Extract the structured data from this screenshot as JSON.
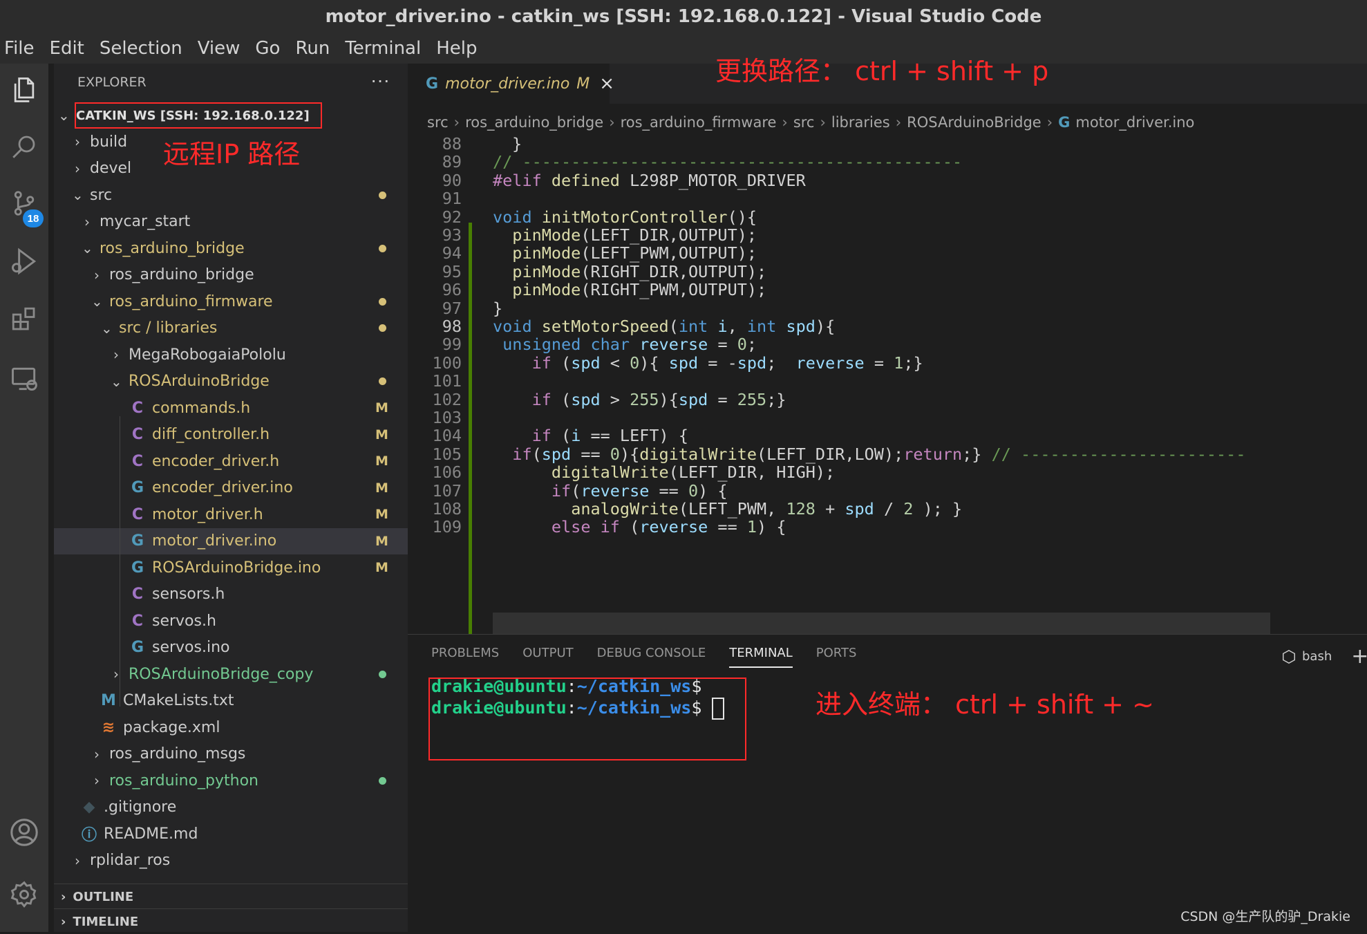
{
  "window": {
    "title": "motor_driver.ino - catkin_ws [SSH: 192.168.0.122] - Visual Studio Code"
  },
  "menu": [
    "File",
    "Edit",
    "Selection",
    "View",
    "Go",
    "Run",
    "Terminal",
    "Help"
  ],
  "activity_bar": {
    "items": [
      "explorer-icon",
      "search-icon",
      "source-control-icon",
      "run-debug-icon",
      "extensions-icon",
      "remote-explorer-icon"
    ],
    "source_control_badge": "18",
    "bottom": [
      "account-icon",
      "gear-icon"
    ]
  },
  "explorer": {
    "header": "EXPLORER",
    "more": "···",
    "root": "CATKIN_WS [SSH: 192.168.0.122]",
    "tree": [
      {
        "label": "build",
        "chev": "›",
        "color": "#cccccc"
      },
      {
        "label": "devel",
        "chev": "›",
        "color": "#cccccc"
      },
      {
        "label": "src",
        "chev": "⌄",
        "color": "#cccccc"
      },
      {
        "label": "mycar_start",
        "chev": "›",
        "color": "#cccccc"
      },
      {
        "label": "ros_arduino_bridge",
        "chev": "⌄",
        "color": "#d6c078"
      },
      {
        "label": "ros_arduino_bridge",
        "chev": "›",
        "color": "#cccccc"
      },
      {
        "label": "ros_arduino_firmware",
        "chev": "⌄",
        "color": "#d6c078"
      },
      {
        "label": "src / libraries",
        "chev": "⌄",
        "color": "#d6c078"
      },
      {
        "label": "MegaRobogaiaPololu",
        "chev": "›",
        "color": "#cccccc"
      },
      {
        "label": "ROSArduinoBridge",
        "chev": "⌄",
        "color": "#d6c078"
      },
      {
        "label": "commands.h",
        "icon": "C",
        "status": "M",
        "color": "#d6c078"
      },
      {
        "label": "diff_controller.h",
        "icon": "C",
        "status": "M",
        "color": "#d6c078"
      },
      {
        "label": "encoder_driver.h",
        "icon": "C",
        "status": "M",
        "color": "#d6c078"
      },
      {
        "label": "encoder_driver.ino",
        "icon": "G",
        "status": "M",
        "color": "#d6c078"
      },
      {
        "label": "motor_driver.h",
        "icon": "C",
        "status": "M",
        "color": "#d6c078"
      },
      {
        "label": "motor_driver.ino",
        "icon": "G",
        "status": "M",
        "color": "#d6c078"
      },
      {
        "label": "ROSArduinoBridge.ino",
        "icon": "G",
        "status": "M",
        "color": "#d6c078"
      },
      {
        "label": "sensors.h",
        "icon": "C",
        "color": "#cccccc"
      },
      {
        "label": "servos.h",
        "icon": "C",
        "color": "#cccccc"
      },
      {
        "label": "servos.ino",
        "icon": "G",
        "color": "#cccccc"
      },
      {
        "label": "ROSArduinoBridge_copy",
        "chev": "›",
        "color": "#73c991"
      },
      {
        "label": "CMakeLists.txt",
        "icon": "M",
        "color": "#cccccc"
      },
      {
        "label": "package.xml",
        "icon": "rss",
        "color": "#cccccc"
      },
      {
        "label": "ros_arduino_msgs",
        "chev": "›",
        "color": "#cccccc"
      },
      {
        "label": "ros_arduino_python",
        "chev": "›",
        "color": "#73c991"
      },
      {
        "label": ".gitignore",
        "icon": "diamond",
        "color": "#cccccc"
      },
      {
        "label": "README.md",
        "icon": "info",
        "color": "#cccccc"
      },
      {
        "label": "rplidar_ros",
        "chev": "›",
        "color": "#cccccc"
      }
    ],
    "outline": "OUTLINE",
    "timeline": "TIMELINE"
  },
  "editor": {
    "tab": {
      "label": "motor_driver.ino",
      "modified": "M",
      "close": "×"
    },
    "breadcrumb": [
      "src",
      "ros_arduino_bridge",
      "ros_arduino_firmware",
      "src",
      "libraries",
      "ROSArduinoBridge",
      "motor_driver.ino"
    ],
    "line_numbers": [
      "88",
      "89",
      "90",
      "91",
      "92",
      "93",
      "94",
      "95",
      "96",
      "97",
      "98",
      "99",
      "100",
      "101",
      "102",
      "103",
      "104",
      "105",
      "106",
      "107",
      "108",
      "109"
    ],
    "current_line": "98"
  },
  "panel": {
    "tabs": [
      "PROBLEMS",
      "OUTPUT",
      "DEBUG CONSOLE",
      "TERMINAL",
      "PORTS"
    ],
    "active_tab": "TERMINAL",
    "shell": "bash",
    "add": "+",
    "terminal": [
      {
        "user": "drakie@ubuntu",
        "colon": ":",
        "path": "~/catkin_ws",
        "prompt": "$"
      },
      {
        "user": "drakie@ubuntu",
        "colon": ":",
        "path": "~/catkin_ws",
        "prompt": "$"
      }
    ]
  },
  "annotations": {
    "path_switch": "更换路径： ctrl + shift + p",
    "remote_ip": "远程IP 路径",
    "terminal": "进入终端： ctrl + shift + ~"
  },
  "watermark": "CSDN @生产队的驴_Drakie"
}
